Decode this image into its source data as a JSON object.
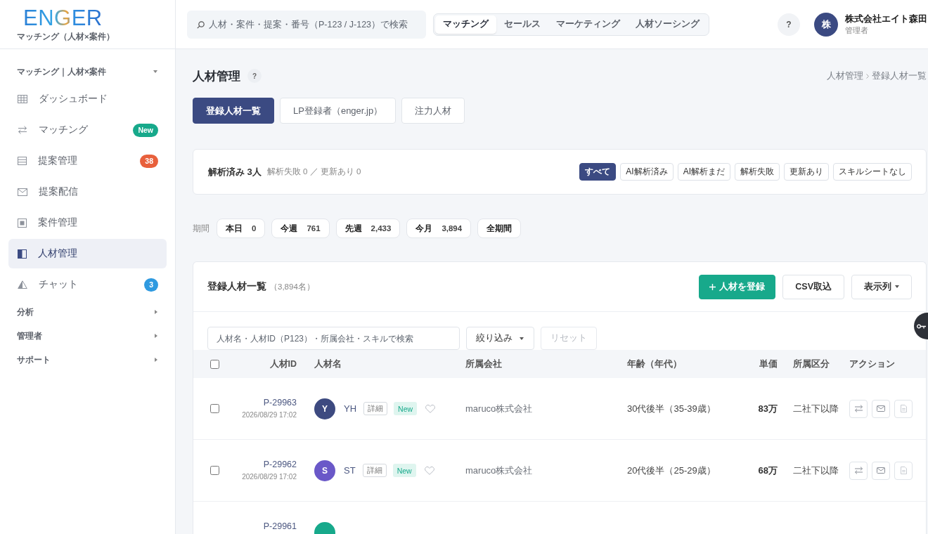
{
  "sidebar": {
    "logo": "ENGER",
    "subtitle": "マッチング（人材×案件）",
    "sections": [
      {
        "label": "マッチング｜人材×案件",
        "expanded": true,
        "items": [
          {
            "kind": "dashboard",
            "label": "ダッシュボード",
            "selected": false
          },
          {
            "kind": "matching",
            "label": "マッチング",
            "selected": false,
            "badge": {
              "text": "New",
              "color": "#17a98b"
            }
          },
          {
            "kind": "proposals",
            "label": "提案管理",
            "selected": false,
            "badge": {
              "text": "38",
              "color": "#e8603c"
            }
          },
          {
            "kind": "delivery",
            "label": "提案配信",
            "selected": false
          },
          {
            "kind": "projects",
            "label": "案件管理",
            "selected": false
          },
          {
            "kind": "talent",
            "label": "人材管理",
            "selected": true
          },
          {
            "kind": "chat",
            "label": "チャット",
            "selected": false,
            "badge": {
              "text": "3",
              "color": "#2f9ae0"
            }
          }
        ]
      },
      {
        "label": "分析",
        "expanded": false
      },
      {
        "label": "管理者",
        "expanded": false
      },
      {
        "label": "サポート",
        "expanded": false
      }
    ]
  },
  "header": {
    "search": {
      "placeholder": "人材・案件・提案・番号（P-123 / J-123）で検索"
    },
    "modes": [
      {
        "label": "マッチング",
        "selected": true
      },
      {
        "label": "セールス",
        "selected": false
      },
      {
        "label": "マーケティング",
        "selected": false
      },
      {
        "label": "人材ソーシング",
        "selected": false
      }
    ],
    "help": "?",
    "user": {
      "avatar": "株",
      "name": "株式会社エイト森田",
      "role": "管理者"
    }
  },
  "page": {
    "title": "人材管理",
    "help": "?",
    "breadcrumb": [
      "人材管理",
      "登録人材一覧"
    ],
    "tabs": [
      {
        "label": "登録人材一覧",
        "selected": true
      },
      {
        "label": "LP登録者（enger.jp）",
        "selected": false
      },
      {
        "label": "注力人材",
        "selected": false
      }
    ]
  },
  "analysis": {
    "summary": "解析済み 3人",
    "detail": "解析失敗 0 ／ 更新あり 0",
    "filters": [
      {
        "label": "すべて",
        "selected": true
      },
      {
        "label": "AI解析済み",
        "selected": false
      },
      {
        "label": "AI解析まだ",
        "selected": false
      },
      {
        "label": "解析失敗",
        "selected": false
      },
      {
        "label": "更新あり",
        "selected": false
      },
      {
        "label": "スキルシートなし",
        "selected": false
      }
    ]
  },
  "period": {
    "label": "期間",
    "options": [
      {
        "label": "本日",
        "count": "0"
      },
      {
        "label": "今週",
        "count": "761"
      },
      {
        "label": "先週",
        "count": "2,433"
      },
      {
        "label": "今月",
        "count": "3,894"
      },
      {
        "label": "全期間"
      }
    ]
  },
  "list": {
    "title": "登録人材一覧",
    "count": "（3,894名）",
    "actions": [
      {
        "kind": "primary",
        "label": "人材を登録"
      },
      {
        "kind": "plain",
        "label": "CSV取込"
      },
      {
        "kind": "dropdown",
        "label": "表示列"
      }
    ],
    "search": {
      "placeholder": "人材名・人材ID（P123）・所属会社・スキルで検索"
    },
    "filter_button": "絞り込み",
    "reset_button": {
      "label": "リセット",
      "disabled": true
    },
    "table": {
      "select_all": {
        "checked": false
      },
      "columns": [
        "人材ID",
        "人材名",
        "所属会社",
        "年齢（年代）",
        "単価",
        "所属区分",
        "アクション"
      ],
      "rows": [
        {
          "checked": false,
          "id": "P-29963",
          "date": "2026/08/29 17:02",
          "avatar": {
            "initial": "Y",
            "color": "#3d4a80"
          },
          "name": "YH",
          "detail": "詳細",
          "tag": "New",
          "favorite": false,
          "company": "maruco株式会社",
          "age": "30代後半（35-39歳）",
          "price": "83万",
          "division": "二社下以降",
          "actions": [
            {
              "kind": "swap",
              "disabled": false
            },
            {
              "kind": "mail",
              "disabled": false
            },
            {
              "kind": "document",
              "disabled": true
            }
          ]
        },
        {
          "checked": false,
          "id": "P-29962",
          "date": "2026/08/29 17:02",
          "avatar": {
            "initial": "S",
            "color": "#6a58c8"
          },
          "name": "ST",
          "detail": "詳細",
          "tag": "New",
          "favorite": false,
          "company": "maruco株式会社",
          "age": "20代後半（25-29歳）",
          "price": "68万",
          "division": "二社下以降",
          "actions": [
            {
              "kind": "swap",
              "disabled": false
            },
            {
              "kind": "mail",
              "disabled": false
            },
            {
              "kind": "document",
              "disabled": true
            }
          ]
        },
        {
          "id": "P-29961",
          "avatar": {
            "color": "#17a98b"
          }
        }
      ]
    }
  }
}
